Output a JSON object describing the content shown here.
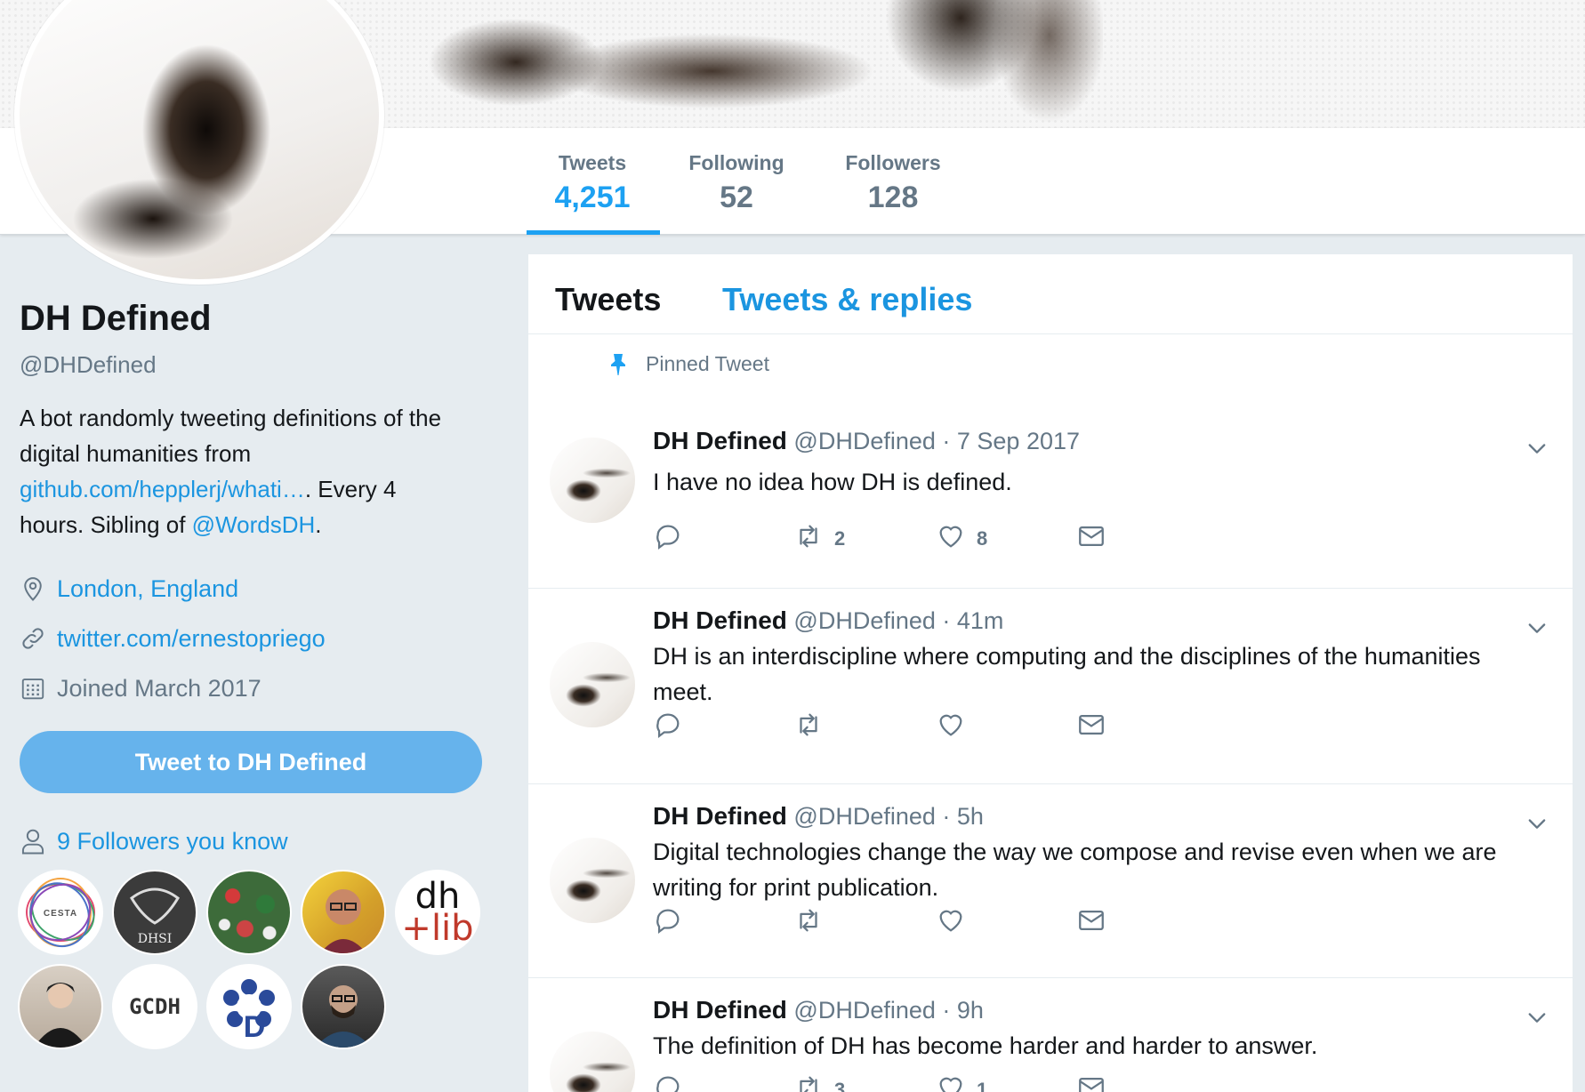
{
  "nav": {
    "tweets_label": "Tweets",
    "tweets_count": "4,251",
    "following_label": "Following",
    "following_count": "52",
    "followers_label": "Followers",
    "followers_count": "128"
  },
  "profile": {
    "name": "DH Defined",
    "handle": "@DHDefined",
    "bio_part1": "A bot randomly tweeting definitions of the digital humanities from ",
    "bio_link": "github.com/hepplerj/whati…",
    "bio_part2": ". Every 4 hours. Sibling of ",
    "bio_mention": "@WordsDH",
    "bio_end": ".",
    "location": "London, England",
    "website": "twitter.com/ernestopriego",
    "joined": "Joined March 2017",
    "tweet_to_button": "Tweet to DH Defined",
    "followers_you_know": "9 Followers you know"
  },
  "followers_you_know": [
    {
      "name": "CESTA",
      "label": "CESTA"
    },
    {
      "name": "DHSI",
      "label": "DHSI"
    },
    {
      "name": "pattern",
      "label": ""
    },
    {
      "name": "person-glasses",
      "label": ""
    },
    {
      "name": "dh-lib",
      "label_top": "dh",
      "label_bottom": "+lib"
    },
    {
      "name": "person-dark",
      "label": ""
    },
    {
      "name": "GCDH",
      "label": "GCDH"
    },
    {
      "name": "D-logo",
      "label": "D"
    },
    {
      "name": "person-beard",
      "label": ""
    }
  ],
  "timeline": {
    "tab_tweets": "Tweets",
    "tab_replies": "Tweets & replies",
    "pinned_label": "Pinned Tweet",
    "tweets": [
      {
        "name": "DH Defined",
        "handle": "@DHDefined",
        "dot": " · ",
        "time": "7 Sep 2017",
        "text": "I have no idea how DH is defined.",
        "retweets": "2",
        "likes": "8"
      },
      {
        "name": "DH Defined",
        "handle": "@DHDefined",
        "dot": " · ",
        "time": "41m",
        "text": "DH is an interdiscipline where computing and the disciplines of the humanities meet.",
        "retweets": "",
        "likes": ""
      },
      {
        "name": "DH Defined",
        "handle": "@DHDefined",
        "dot": " · ",
        "time": "5h",
        "text": "Digital technologies change the way we compose and revise even when we are writing for print publication.",
        "retweets": "",
        "likes": ""
      },
      {
        "name": "DH Defined",
        "handle": "@DHDefined",
        "dot": " · ",
        "time": "9h",
        "text": "The definition of DH has become harder and harder to answer.",
        "retweets": "3",
        "likes": "1"
      }
    ]
  },
  "colors": {
    "accent": "#1da1f2",
    "link": "#1b95e0",
    "button": "#66b3ec",
    "muted": "#657786"
  }
}
